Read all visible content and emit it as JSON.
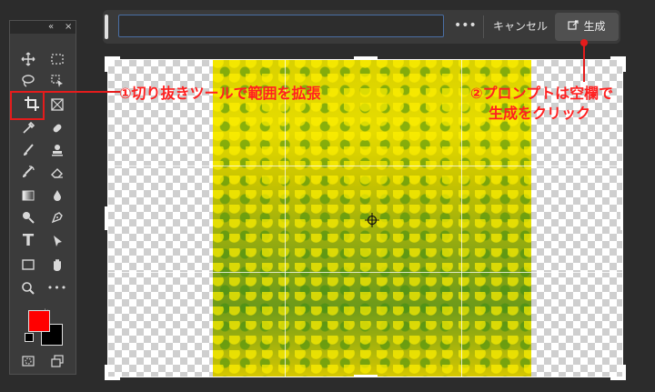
{
  "toolbar": {
    "collapse_icon": "«",
    "close_icon": "×",
    "tools": [
      {
        "name": "move-tool",
        "icon": "move-icon"
      },
      {
        "name": "marquee-tool",
        "icon": "marquee-icon"
      },
      {
        "name": "lasso-tool",
        "icon": "lasso-icon"
      },
      {
        "name": "object-select-tool",
        "icon": "object-select-icon"
      },
      {
        "name": "crop-tool",
        "icon": "crop-icon"
      },
      {
        "name": "frame-tool",
        "icon": "frame-icon"
      },
      {
        "name": "eyedropper-tool",
        "icon": "eyedropper-icon"
      },
      {
        "name": "healing-tool",
        "icon": "healing-icon"
      },
      {
        "name": "brush-tool",
        "icon": "brush-icon"
      },
      {
        "name": "stamp-tool",
        "icon": "stamp-icon"
      },
      {
        "name": "history-brush-tool",
        "icon": "history-brush-icon"
      },
      {
        "name": "eraser-tool",
        "icon": "eraser-icon"
      },
      {
        "name": "gradient-tool",
        "icon": "gradient-icon"
      },
      {
        "name": "blur-tool",
        "icon": "blur-icon"
      },
      {
        "name": "dodge-tool",
        "icon": "dodge-icon"
      },
      {
        "name": "pen-tool",
        "icon": "pen-icon"
      },
      {
        "name": "type-tool",
        "icon": "type-icon"
      },
      {
        "name": "path-select-tool",
        "icon": "path-select-icon"
      },
      {
        "name": "rectangle-tool",
        "icon": "rectangle-icon"
      },
      {
        "name": "hand-tool",
        "icon": "hand-icon"
      },
      {
        "name": "zoom-tool",
        "icon": "zoom-icon"
      },
      {
        "name": "more-tools",
        "icon": "ellipsis-icon"
      }
    ],
    "type_glyph": "T",
    "more_glyph": "•••",
    "foreground_color": "#ff0000",
    "background_color": "#000000"
  },
  "prompt_bar": {
    "input_value": "",
    "input_placeholder": "",
    "more_label": "•••",
    "cancel_label": "キャンセル",
    "generate_label": "生成",
    "generate_icon": "generate-icon"
  },
  "callouts": {
    "step1": "①切り抜きツールで範囲を拡張",
    "step2_line1": "②プロンプトは空欄で",
    "step2_line2": "生成をクリック",
    "color": "#e41c1c"
  }
}
